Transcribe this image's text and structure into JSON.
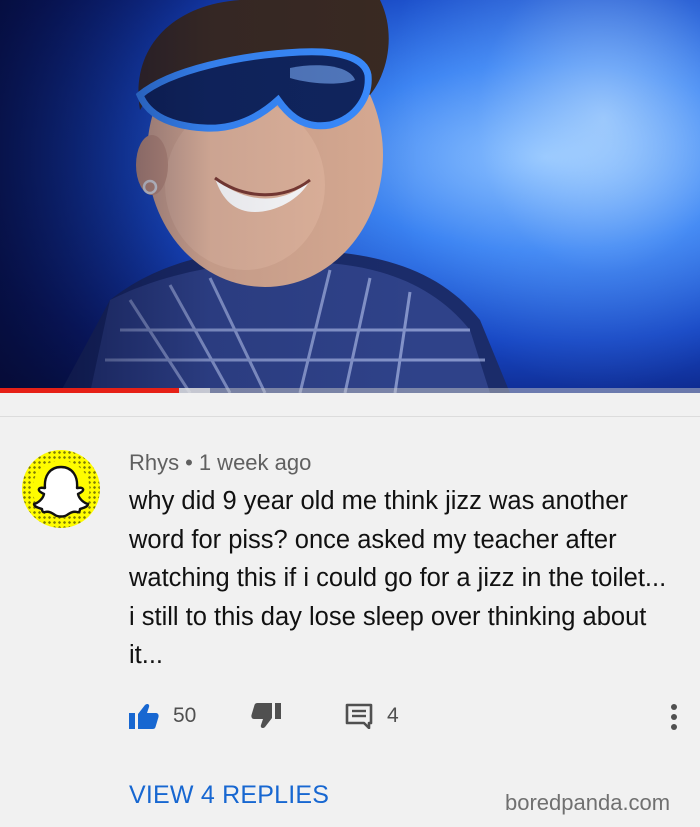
{
  "video": {
    "progress_fraction": 0.255,
    "buffer_fraction": 0.3
  },
  "comment": {
    "author": "Rhys",
    "separator": "•",
    "time": "1 week ago",
    "text": "why did 9 year old me think jizz was another word for piss? once asked my teacher after watching this if i could go for a jizz in the toilet... i still to this day lose sleep over thinking about it...",
    "likes": "50",
    "replies_count": "4",
    "view_replies_label": "VIEW 4 REPLIES"
  },
  "icons": {
    "like": "thumbs-up-icon",
    "dislike": "thumbs-down-icon",
    "reply": "comment-icon",
    "more": "more-vertical-icon",
    "avatar": "snapchat-ghost-icon"
  },
  "colors": {
    "accent": "#1767d1",
    "progress": "#e62117",
    "avatar_bg": "#fffc00"
  },
  "watermark": "boredpanda.com"
}
